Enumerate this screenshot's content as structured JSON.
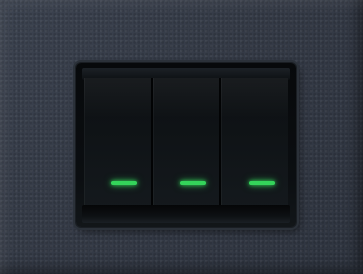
{
  "scene": {
    "plate_color": "#373d48",
    "switch_color": "#0b0e11",
    "led_color": "#34d45a"
  },
  "switch": {
    "gang_count": 3,
    "rockers": [
      {
        "led_state": "on"
      },
      {
        "led_state": "on"
      },
      {
        "led_state": "on"
      }
    ]
  }
}
